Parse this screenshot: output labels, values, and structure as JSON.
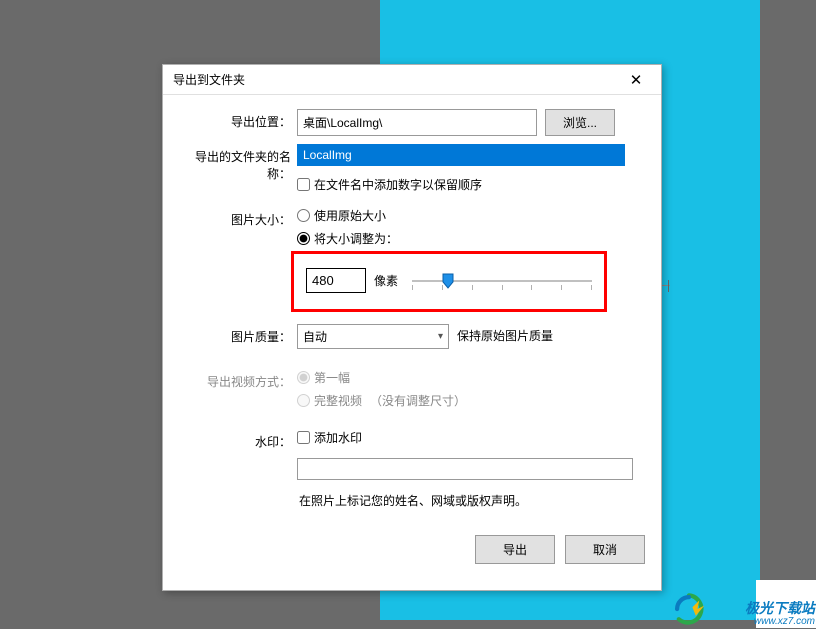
{
  "dialog": {
    "title": "导出到文件夹",
    "close_icon": "✕"
  },
  "location": {
    "label": "导出位置：",
    "value": "桌面\\LocalImg\\",
    "browse": "浏览..."
  },
  "folder": {
    "label": "导出的文件夹的名称：",
    "value": "LocalImg",
    "checkbox": "在文件名中添加数字以保留顺序"
  },
  "size": {
    "label": "图片大小：",
    "opt_original": "使用原始大小",
    "opt_resize": "将大小调整为：",
    "pixel_value": "480",
    "pixel_unit": "像素"
  },
  "quality": {
    "label": "图片质量：",
    "value": "自动",
    "note": "保持原始图片质量"
  },
  "video": {
    "label": "导出视频方式：",
    "opt_first": "第一幅",
    "opt_full": "完整视频",
    "full_note": "（没有调整尺寸）"
  },
  "wm": {
    "label": "水印：",
    "checkbox": "添加水印",
    "note": "在照片上标记您的姓名、网域或版权声明。"
  },
  "footer": {
    "export": "导出",
    "cancel": "取消"
  },
  "brand": {
    "name": "极光下载站",
    "url": "www.xz7.com"
  }
}
